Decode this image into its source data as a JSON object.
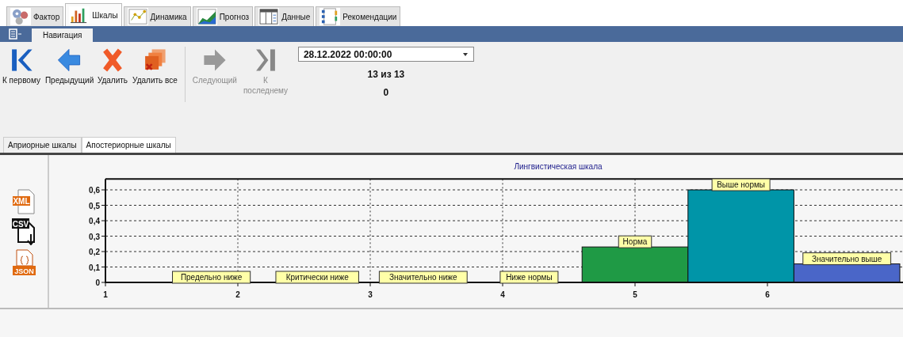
{
  "main_tabs": [
    {
      "label": "Фактор",
      "kind": "factor",
      "selected": false
    },
    {
      "label": "Шкалы",
      "kind": "scales",
      "selected": true
    },
    {
      "label": "Динамика",
      "kind": "dynamics",
      "selected": false
    },
    {
      "label": "Прогноз",
      "kind": "forecast",
      "selected": false
    },
    {
      "label": "Данные",
      "kind": "data",
      "selected": false
    },
    {
      "label": "Рекомендации",
      "kind": "recommend",
      "selected": false
    }
  ],
  "ribbon_tabs": [
    {
      "label": "Навигация",
      "selected": true
    }
  ],
  "toolbar": {
    "buttons": [
      {
        "label": "К первому",
        "kind": "first",
        "disabled": false
      },
      {
        "label": "Предыдущий",
        "kind": "prev",
        "disabled": false
      },
      {
        "label": "Удалить",
        "kind": "delete",
        "disabled": false
      },
      {
        "label": "Удалить все",
        "kind": "delete_all",
        "disabled": false
      },
      {
        "label": "Следующий",
        "kind": "next",
        "disabled": true
      },
      {
        "label": "К последнему",
        "kind": "last",
        "disabled": true
      }
    ],
    "date": "28.12.2022 00:00:00",
    "counter": "13 из 13",
    "value": "0"
  },
  "sub_tabs": [
    {
      "label": "Априорные шкалы",
      "selected": false
    },
    {
      "label": "Апостериорные шкалы",
      "selected": true
    }
  ],
  "export_buttons": [
    {
      "label": "XML",
      "kind": "xml"
    },
    {
      "label": "CSV",
      "kind": "csv"
    },
    {
      "label": "JSON",
      "kind": "json"
    }
  ],
  "chart": {
    "chart_data": {
      "type": "bar",
      "title": "Лингвистическая шкала",
      "x": [
        1.8,
        2.6,
        3.4,
        4.2,
        5.0,
        5.8,
        6.6
      ],
      "series": [
        {
          "values": [
            0,
            0,
            0,
            0,
            0.23,
            0.6,
            0.12
          ]
        }
      ],
      "value_labels": [
        "Предельно ниже",
        "Критически ниже",
        "Значительно ниже",
        "Ниже нормы",
        "Норма",
        "Выше нормы",
        "Значительно выше"
      ],
      "grid": true,
      "colors": [
        "#1f9a45",
        "#1f9a45",
        "#1f9a45",
        "#1f9a45",
        "#1f9a45",
        "#0095a8",
        "#4a66c8"
      ],
      "xlim": [
        1,
        7
      ],
      "ylim": [
        0,
        0.67
      ],
      "xticks": [
        {
          "value": 1,
          "label": "1"
        },
        {
          "value": 2,
          "label": "2"
        },
        {
          "value": 3,
          "label": "3"
        },
        {
          "value": 4,
          "label": "4"
        },
        {
          "value": 5,
          "label": "5"
        },
        {
          "value": 6,
          "label": "6"
        }
      ],
      "yticks": [
        {
          "value": 0,
          "label": "0"
        },
        {
          "value": 0.1,
          "label": "0,1"
        },
        {
          "value": 0.2,
          "label": "0,2"
        },
        {
          "value": 0.3,
          "label": "0,3"
        },
        {
          "value": 0.4,
          "label": "0,4"
        },
        {
          "value": 0.5,
          "label": "0,5"
        },
        {
          "value": 0.6,
          "label": "0,6"
        }
      ],
      "stacked": false
    }
  }
}
